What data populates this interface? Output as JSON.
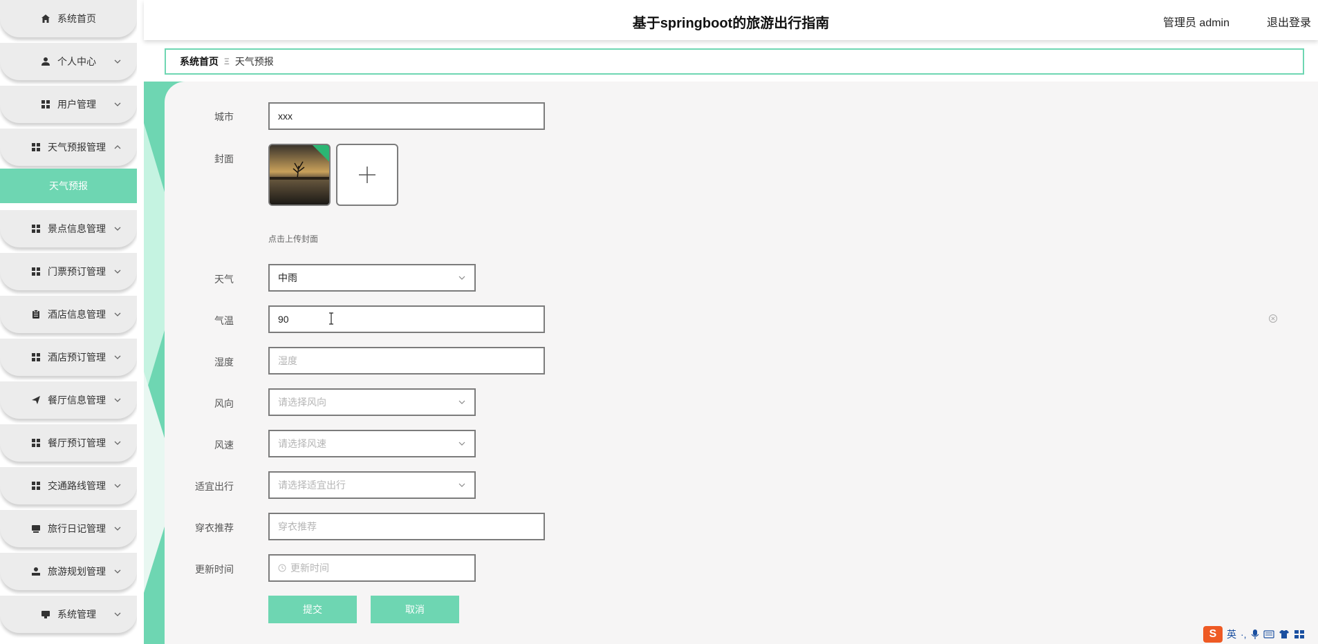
{
  "sidebar": {
    "items": [
      {
        "label": "系统首页",
        "icon": "home-icon",
        "has_chevron": false
      },
      {
        "label": "个人中心",
        "icon": "user-icon",
        "has_chevron": true
      },
      {
        "label": "用户管理",
        "icon": "grid-icon",
        "has_chevron": true
      },
      {
        "label": "天气预报管理",
        "icon": "grid-icon",
        "has_chevron": true,
        "expanded": true
      },
      {
        "label": "景点信息管理",
        "icon": "grid-icon",
        "has_chevron": true
      },
      {
        "label": "门票预订管理",
        "icon": "grid-icon",
        "has_chevron": true
      },
      {
        "label": "酒店信息管理",
        "icon": "clipboard-icon",
        "has_chevron": true
      },
      {
        "label": "酒店预订管理",
        "icon": "grid-icon",
        "has_chevron": true
      },
      {
        "label": "餐厅信息管理",
        "icon": "send-icon",
        "has_chevron": true
      },
      {
        "label": "餐厅预订管理",
        "icon": "grid-icon",
        "has_chevron": true
      },
      {
        "label": "交通路线管理",
        "icon": "grid-icon",
        "has_chevron": true
      },
      {
        "label": "旅行日记管理",
        "icon": "monitor-icon",
        "has_chevron": true
      },
      {
        "label": "旅游规划管理",
        "icon": "person-icon",
        "has_chevron": true
      },
      {
        "label": "系统管理",
        "icon": "monitor-icon",
        "has_chevron": true
      }
    ],
    "active_sub": "天气预报"
  },
  "header": {
    "title": "基于springboot的旅游出行指南",
    "user": "管理员 admin",
    "logout": "退出登录"
  },
  "breadcrumb": {
    "home": "系统首页",
    "separator": "Ξ",
    "current": "天气预报"
  },
  "form": {
    "city": {
      "label": "城市",
      "value": "xxx"
    },
    "cover": {
      "label": "封面",
      "hint": "点击上传封面"
    },
    "weather": {
      "label": "天气",
      "value": "中雨"
    },
    "temperature": {
      "label": "气温",
      "value": "90"
    },
    "humidity": {
      "label": "湿度",
      "placeholder": "湿度"
    },
    "wind_direction": {
      "label": "风向",
      "placeholder": "请选择风向"
    },
    "wind_speed": {
      "label": "风速",
      "placeholder": "请选择风速"
    },
    "travel_suitable": {
      "label": "适宜出行",
      "placeholder": "请选择适宜出行"
    },
    "clothing": {
      "label": "穿衣推荐",
      "placeholder": "穿衣推荐"
    },
    "update_time": {
      "label": "更新时间",
      "placeholder": "更新时间"
    },
    "submit": "提交",
    "cancel": "取消"
  },
  "ime": {
    "mode": "英",
    "punct": "·,"
  },
  "colors": {
    "accent": "#6ed6b2",
    "panel": "#f6f5f5",
    "nav_bg": "#ececec"
  }
}
